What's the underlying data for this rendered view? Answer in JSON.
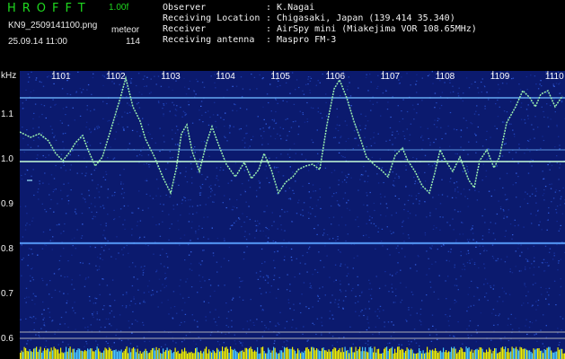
{
  "header": {
    "brand": "HROFFT",
    "version": "1.00f",
    "filename": "KN9_2509141100.png",
    "mode": "meteor",
    "datetime": "25.09.14 11:00",
    "count": "114",
    "info": [
      {
        "key": "Observer",
        "value": ": K.Nagai"
      },
      {
        "key": "Receiving Location",
        "value": ": Chigasaki, Japan (139.414 35.340)"
      },
      {
        "key": "Receiver",
        "value": ": AirSpy mini (Miakejima VOR 108.65MHz)"
      },
      {
        "key": "Receiving antenna",
        "value": ": Maspro FM-3"
      }
    ]
  },
  "spectrogram": {
    "y_unit": "kHz",
    "y_ticks": [
      "1.1",
      "1.0",
      "0.9",
      "0.8",
      "0.7",
      "0.6"
    ],
    "x_ticks": [
      "1101",
      "1102",
      "1103",
      "1104",
      "1105",
      "1106",
      "1107",
      "1108",
      "1109",
      "1110"
    ],
    "colors": {
      "background": "#0b1a6e",
      "carrier": "#9ee8ff",
      "trace": "#9cf2b0",
      "bottom_band": "#f2f200"
    }
  }
}
